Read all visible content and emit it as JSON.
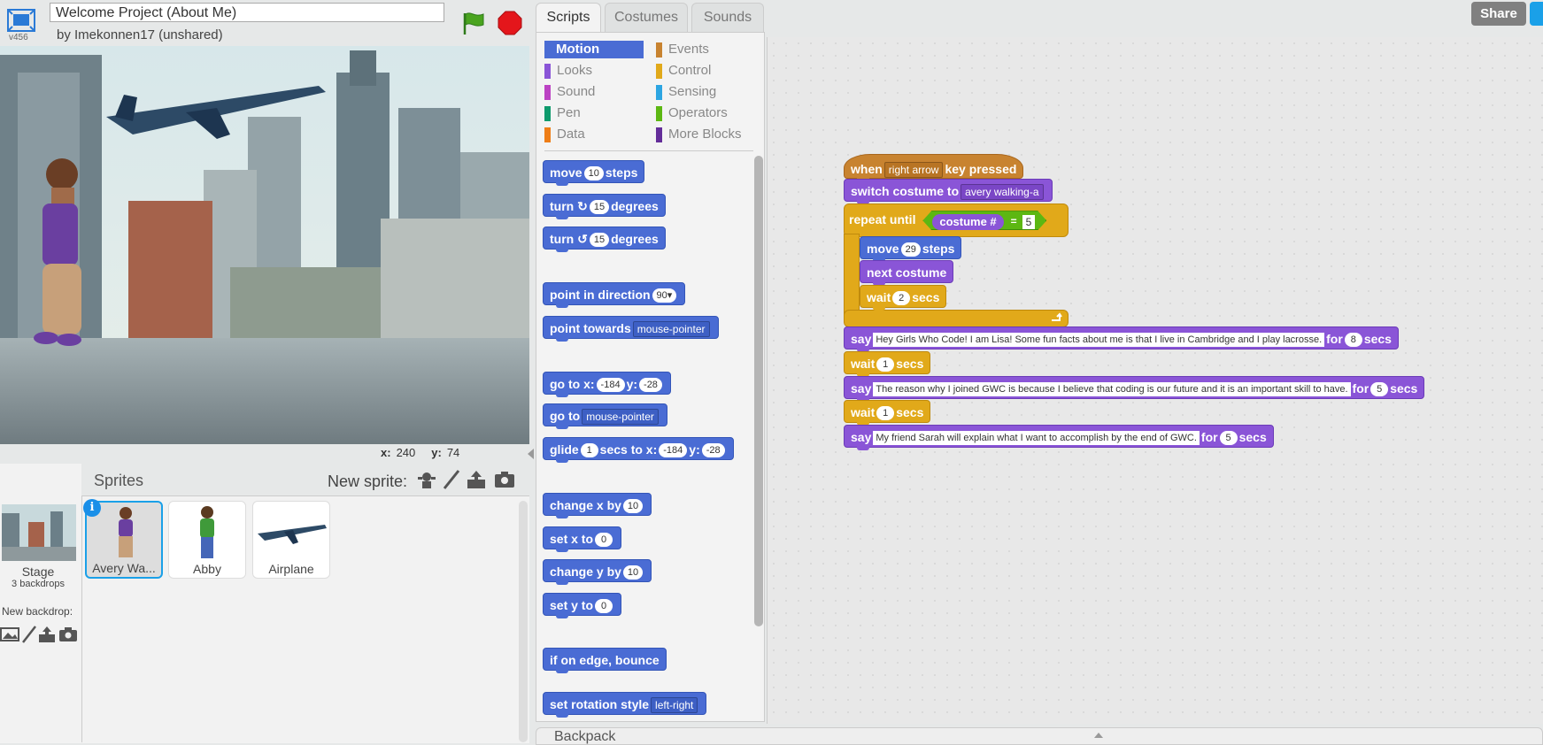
{
  "project": {
    "title": "Welcome Project (About Me)",
    "byline": "by Imekonnen17 (unshared)",
    "version": "v456"
  },
  "stage": {
    "x_label": "x:",
    "x_value": "240",
    "y_label": "y:",
    "y_value": "74"
  },
  "sprites_pane": {
    "title": "Sprites",
    "new_sprite_label": "New sprite:",
    "stage_name": "Stage",
    "stage_backdrops": "3 backdrops",
    "new_backdrop_label": "New backdrop:",
    "info_badge": "i",
    "sprites": [
      {
        "name": "Avery Wa..."
      },
      {
        "name": "Abby"
      },
      {
        "name": "Airplane"
      }
    ]
  },
  "tabs": [
    {
      "label": "Scripts"
    },
    {
      "label": "Costumes"
    },
    {
      "label": "Sounds"
    }
  ],
  "categories": [
    {
      "label": "Motion",
      "color": "#4a6cd4"
    },
    {
      "label": "Events",
      "color": "#c88330"
    },
    {
      "label": "Looks",
      "color": "#8a55d7"
    },
    {
      "label": "Control",
      "color": "#e1a91a"
    },
    {
      "label": "Sound",
      "color": "#bb42c3"
    },
    {
      "label": "Sensing",
      "color": "#2ca5e2"
    },
    {
      "label": "Pen",
      "color": "#0e9a6c"
    },
    {
      "label": "Operators",
      "color": "#5cb712"
    },
    {
      "label": "Data",
      "color": "#ee7d16"
    },
    {
      "label": "More Blocks",
      "color": "#632d99"
    }
  ],
  "palette": {
    "move": {
      "a": "move",
      "n": "10",
      "b": "steps"
    },
    "turn_cw": {
      "a": "turn",
      "n": "15",
      "b": "degrees"
    },
    "turn_ccw": {
      "a": "turn",
      "n": "15",
      "b": "degrees"
    },
    "point_dir": {
      "a": "point in direction",
      "n": "90▾"
    },
    "point_towards": {
      "a": "point towards",
      "d": "mouse-pointer"
    },
    "go_to_xy": {
      "a": "go to x:",
      "x": "-184",
      "b": "y:",
      "y": "-28"
    },
    "go_to": {
      "a": "go to",
      "d": "mouse-pointer"
    },
    "glide": {
      "a": "glide",
      "n": "1",
      "b": "secs to x:",
      "x": "-184",
      "c": "y:",
      "y": "-28"
    },
    "change_x": {
      "a": "change x by",
      "n": "10"
    },
    "set_x": {
      "a": "set x to",
      "n": "0"
    },
    "change_y": {
      "a": "change y by",
      "n": "10"
    },
    "set_y": {
      "a": "set y to",
      "n": "0"
    },
    "bounce": {
      "a": "if on edge, bounce"
    },
    "rotation": {
      "a": "set rotation style",
      "d": "left-right"
    }
  },
  "script": {
    "hat": {
      "a": "when",
      "d": "right arrow",
      "b": "key pressed"
    },
    "switch": {
      "a": "switch costume to",
      "d": "avery walking-a"
    },
    "repeat": {
      "a": "repeat until",
      "r": "costume #",
      "op": "=",
      "v": "5"
    },
    "move": {
      "a": "move",
      "n": "29",
      "b": "steps"
    },
    "next": {
      "a": "next costume"
    },
    "wait_inner": {
      "a": "wait",
      "n": "2",
      "b": "secs"
    },
    "say1": {
      "a": "say",
      "t": "Hey Girls Who Code! I am Lisa! Some fun facts about me is that I live in Cambridge and I play lacrosse.",
      "b": "for",
      "n": "8",
      "c": "secs"
    },
    "wait1": {
      "a": "wait",
      "n": "1",
      "b": "secs"
    },
    "say2": {
      "a": "say",
      "t": "The reason why I joined GWC is because I believe that coding is our future and it is an important skill to have.",
      "b": "for",
      "n": "5",
      "c": "secs"
    },
    "wait2": {
      "a": "wait",
      "n": "1",
      "b": "secs"
    },
    "say3": {
      "a": "say",
      "t": "My friend Sarah will explain what I want to accomplish by the end of GWC.",
      "b": "for",
      "n": "5",
      "c": "secs"
    }
  },
  "share_label": "Share",
  "backpack_label": "Backpack",
  "icons": [
    "fullscreen-icon",
    "green-flag-icon",
    "stop-icon",
    "paint-brush-icon",
    "upload-icon",
    "camera-icon",
    "turn-right-icon",
    "turn-left-icon"
  ]
}
